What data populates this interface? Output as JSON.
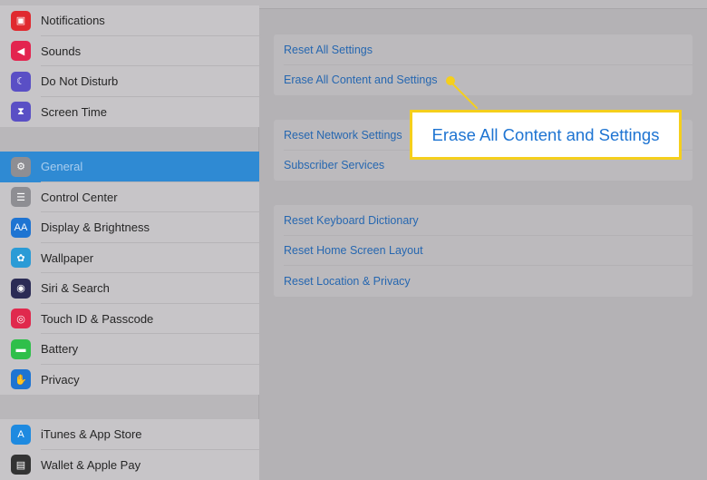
{
  "sidebar": {
    "group1": [
      {
        "label": "Notifications",
        "icon": "notifications-icon",
        "color": "#e0292f",
        "glyph": "▣"
      },
      {
        "label": "Sounds",
        "icon": "sounds-icon",
        "color": "#e3244f",
        "glyph": "◀"
      },
      {
        "label": "Do Not Disturb",
        "icon": "moon-icon",
        "color": "#5a4fc5",
        "glyph": "☾"
      },
      {
        "label": "Screen Time",
        "icon": "hourglass-icon",
        "color": "#5a4fc5",
        "glyph": "⧗"
      }
    ],
    "group2": [
      {
        "label": "General",
        "icon": "gear-icon",
        "color": "#8e8e93",
        "glyph": "⚙",
        "selected": true
      },
      {
        "label": "Control Center",
        "icon": "control-center-icon",
        "color": "#8e8e93",
        "glyph": "☰"
      },
      {
        "label": "Display & Brightness",
        "icon": "display-icon",
        "color": "#1e74d2",
        "glyph": "AA"
      },
      {
        "label": "Wallpaper",
        "icon": "wallpaper-icon",
        "color": "#2a9bd6",
        "glyph": "✿"
      },
      {
        "label": "Siri & Search",
        "icon": "siri-icon",
        "color": "#2b2b55",
        "glyph": "◉"
      },
      {
        "label": "Touch ID & Passcode",
        "icon": "fingerprint-icon",
        "color": "#e0294d",
        "glyph": "◎"
      },
      {
        "label": "Battery",
        "icon": "battery-icon",
        "color": "#2fbf4a",
        "glyph": "▬"
      },
      {
        "label": "Privacy",
        "icon": "hand-icon",
        "color": "#1e74d2",
        "glyph": "✋"
      }
    ],
    "group3": [
      {
        "label": "iTunes & App Store",
        "icon": "app-store-icon",
        "color": "#1e8ae0",
        "glyph": "A"
      },
      {
        "label": "Wallet & Apple Pay",
        "icon": "wallet-icon",
        "color": "#333333",
        "glyph": "▤"
      }
    ]
  },
  "main": {
    "groups": [
      [
        "Reset All Settings",
        "Erase All Content and Settings"
      ],
      [
        "Reset Network Settings",
        "Subscriber Services"
      ],
      [
        "Reset Keyboard Dictionary",
        "Reset Home Screen Layout",
        "Reset Location & Privacy"
      ]
    ]
  },
  "callout": {
    "text": "Erase All Content and Settings",
    "color": "#f5cf1c"
  }
}
